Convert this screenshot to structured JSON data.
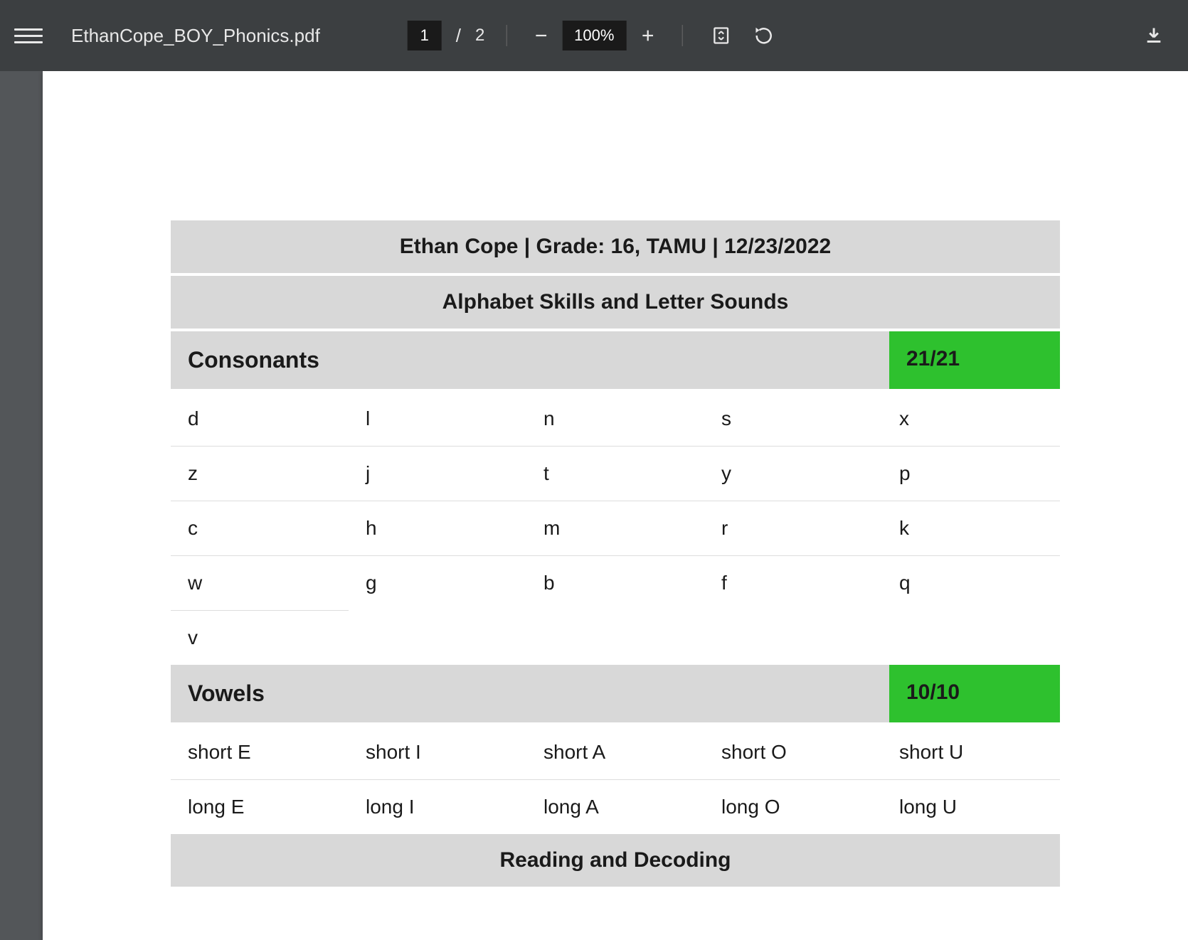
{
  "toolbar": {
    "filename": "EthanCope_BOY_Phonics.pdf",
    "current_page": "1",
    "total_pages": "2",
    "zoom": "100%"
  },
  "report": {
    "header": "Ethan Cope | Grade: 16, TAMU | 12/23/2022",
    "section1_title": "Alphabet Skills and Letter Sounds",
    "consonants": {
      "label": "Consonants",
      "score": "21/21",
      "rows": [
        [
          "d",
          "l",
          "n",
          "s",
          "x"
        ],
        [
          "z",
          "j",
          "t",
          "y",
          "p"
        ],
        [
          "c",
          "h",
          "m",
          "r",
          "k"
        ],
        [
          "w",
          "g",
          "b",
          "f",
          "q"
        ],
        [
          "v",
          "",
          "",
          "",
          ""
        ]
      ]
    },
    "vowels": {
      "label": "Vowels",
      "score": "10/10",
      "rows": [
        [
          "short E",
          "short I",
          "short A",
          "short O",
          "short U"
        ],
        [
          "long E",
          "long I",
          "long A",
          "long O",
          "long U"
        ]
      ]
    },
    "section2_title": "Reading and Decoding"
  }
}
